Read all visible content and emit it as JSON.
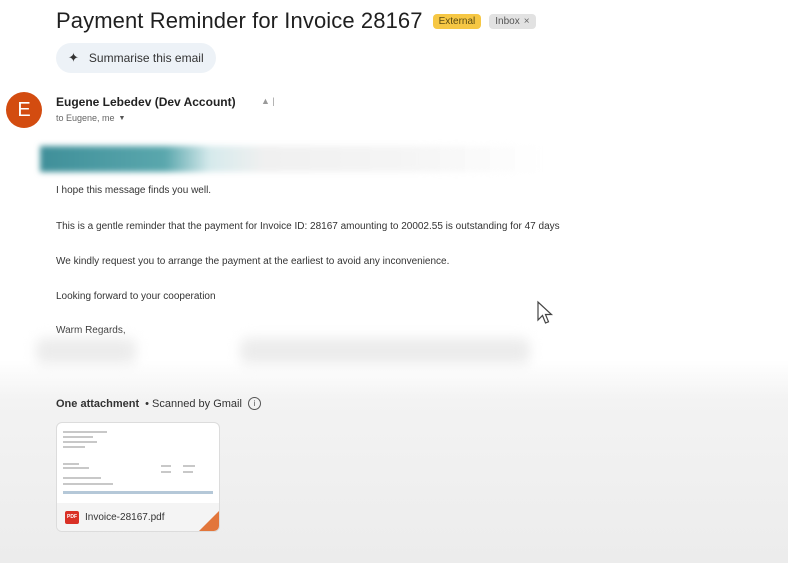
{
  "email": {
    "subject": "Payment Reminder for Invoice 28167",
    "labels": {
      "external": "External",
      "inbox": "Inbox",
      "inbox_close": "×"
    },
    "summarise_label": "Summarise this email",
    "sender": {
      "initial": "E",
      "name": "Eugene Lebedev (Dev Account)",
      "recipients": "to Eugene, me"
    },
    "body": [
      "I hope this message finds you well.",
      "This is a gentle reminder that the payment for Invoice ID:  28167 amounting to  20002.55 is outstanding for 47 days",
      "We kindly request you to arrange the payment at the earliest to avoid any inconvenience.",
      "Looking forward to your cooperation",
      "Warm Regards,"
    ]
  },
  "attachments": {
    "heading": "One attachment",
    "scanned": "• Scanned by Gmail",
    "files": [
      {
        "name": "Invoice-28167.pdf",
        "type": "PDF"
      }
    ]
  },
  "icons": {
    "summarise": "sparkle-icon",
    "info": "info-icon",
    "file": "pdf-icon",
    "cursor": "mouse-cursor-icon"
  },
  "colors": {
    "avatar": "#d34c10",
    "external_label": "#f6c744",
    "pdf": "#d93025"
  }
}
